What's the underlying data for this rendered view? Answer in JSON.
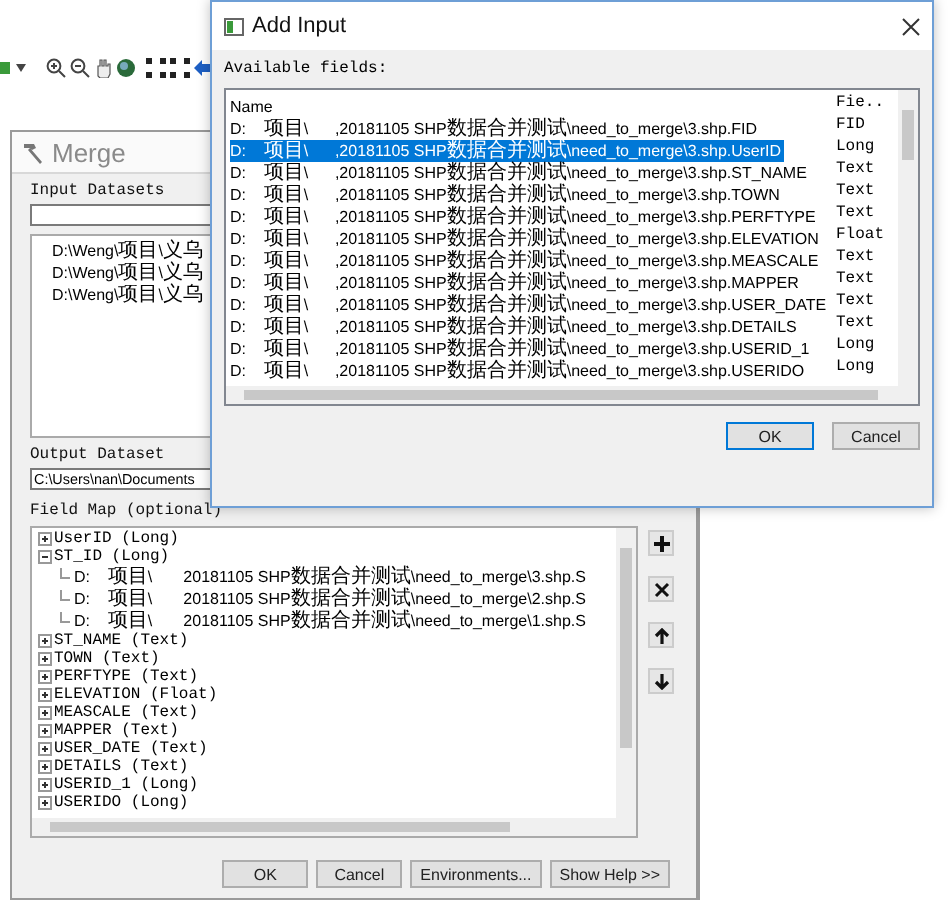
{
  "merge_window": {
    "title": "Merge",
    "input_datasets": {
      "label": "Input Datasets",
      "items": [
        "D:\\Weng\\项目\\义乌",
        "D:\\Weng\\项目\\义乌",
        "D:\\Weng\\项目\\义乌"
      ]
    },
    "output_dataset": {
      "label": "Output Dataset",
      "value": "C:\\Users\\nan\\Documents"
    },
    "field_map": {
      "label": "Field Map (optional)",
      "tree": [
        {
          "label": "UserID (Long)",
          "expanded": false
        },
        {
          "label": "ST_ID (Long)",
          "expanded": true,
          "children": [
            {
              "label": "D:    项目\\       20181105 SHP数据合并测试\\need_to_merge\\3.shp.S"
            },
            {
              "label": "D:    项目\\       20181105 SHP数据合并测试\\need_to_merge\\2.shp.S"
            },
            {
              "label": "D:    项目\\       20181105 SHP数据合并测试\\need_to_merge\\1.shp.S"
            }
          ]
        },
        {
          "label": "ST_NAME (Text)",
          "expanded": false
        },
        {
          "label": "TOWN (Text)",
          "expanded": false
        },
        {
          "label": "PERFTYPE (Text)",
          "expanded": false
        },
        {
          "label": "ELEVATION (Float)",
          "expanded": false
        },
        {
          "label": "MEASCALE (Text)",
          "expanded": false
        },
        {
          "label": "MAPPER (Text)",
          "expanded": false
        },
        {
          "label": "USER_DATE (Text)",
          "expanded": false
        },
        {
          "label": "DETAILS (Text)",
          "expanded": false
        },
        {
          "label": "USERID_1 (Long)",
          "expanded": false
        },
        {
          "label": "USERIDO (Long)",
          "expanded": false
        }
      ]
    },
    "buttons": [
      "OK",
      "Cancel",
      "Environments...",
      "Show Help >>"
    ]
  },
  "add_input": {
    "title": "Add Input",
    "label": "Available fields:",
    "columns": [
      "Name",
      "Fie.."
    ],
    "rows": [
      {
        "name": "D:    项目\\      ,20181105 SHP数据合并测试\\need_to_merge\\3.shp.FID",
        "type": "FID",
        "selected": false
      },
      {
        "name": "D:    项目\\      ,20181105 SHP数据合并测试\\need_to_merge\\3.shp.UserID",
        "type": "Long",
        "selected": true
      },
      {
        "name": "D:    项目\\      ,20181105 SHP数据合并测试\\need_to_merge\\3.shp.ST_NAME",
        "type": "Text",
        "selected": false
      },
      {
        "name": "D:    项目\\      ,20181105 SHP数据合并测试\\need_to_merge\\3.shp.TOWN",
        "type": "Text",
        "selected": false
      },
      {
        "name": "D:    项目\\      ,20181105 SHP数据合并测试\\need_to_merge\\3.shp.PERFTYPE",
        "type": "Text",
        "selected": false
      },
      {
        "name": "D:    项目\\      ,20181105 SHP数据合并测试\\need_to_merge\\3.shp.ELEVATION",
        "type": "Float",
        "selected": false
      },
      {
        "name": "D:    项目\\      ,20181105 SHP数据合并测试\\need_to_merge\\3.shp.MEASCALE",
        "type": "Text",
        "selected": false
      },
      {
        "name": "D:    项目\\      ,20181105 SHP数据合并测试\\need_to_merge\\3.shp.MAPPER",
        "type": "Text",
        "selected": false
      },
      {
        "name": "D:    项目\\      ,20181105 SHP数据合并测试\\need_to_merge\\3.shp.USER_DATE",
        "type": "Text",
        "selected": false
      },
      {
        "name": "D:    项目\\      ,20181105 SHP数据合并测试\\need_to_merge\\3.shp.DETAILS",
        "type": "Text",
        "selected": false
      },
      {
        "name": "D:    项目\\      ,20181105 SHP数据合并测试\\need_to_merge\\3.shp.USERID_1",
        "type": "Long",
        "selected": false
      },
      {
        "name": "D:    项目\\      ,20181105 SHP数据合并测试\\need_to_merge\\3.shp.USERIDO",
        "type": "Long",
        "selected": false
      }
    ],
    "buttons": [
      "OK",
      "Cancel"
    ]
  }
}
